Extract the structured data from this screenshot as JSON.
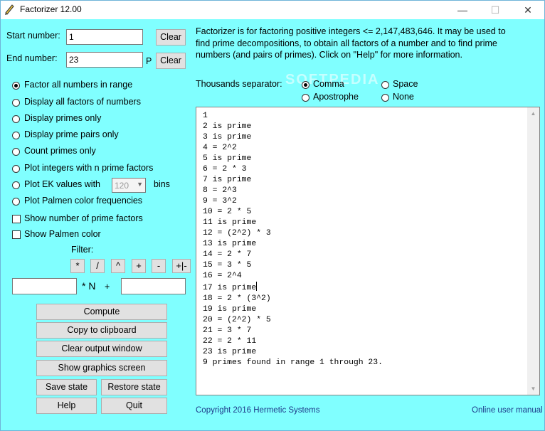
{
  "window": {
    "title": "Factorizer 12.00",
    "minimize": "—",
    "maximize": "☐",
    "close": "✕"
  },
  "inputs": {
    "start_label": "Start number:",
    "start_value": "1",
    "start_clear": "Clear",
    "end_label": "End number:",
    "end_value": "23",
    "end_p": "P",
    "end_clear": "Clear"
  },
  "modes": [
    {
      "label": "Factor all numbers in range",
      "selected": true
    },
    {
      "label": "Display all factors of numbers",
      "selected": false
    },
    {
      "label": "Display primes only",
      "selected": false
    },
    {
      "label": "Display prime pairs only",
      "selected": false
    },
    {
      "label": "Count primes only",
      "selected": false
    },
    {
      "label": "Plot integers with n  prime factors",
      "selected": false
    },
    {
      "label": "Plot EK values with",
      "selected": false,
      "combo_value": "120",
      "suffix": "bins"
    },
    {
      "label": "Plot Palmen color frequencies",
      "selected": false
    }
  ],
  "checks": [
    {
      "label": "Show number of prime factors",
      "checked": false
    },
    {
      "label": "Show Palmen color",
      "checked": false
    }
  ],
  "filter": {
    "label": "Filter:",
    "ops": [
      "*",
      "/",
      "^",
      "+",
      "-",
      "+|-"
    ],
    "times_n": "* N",
    "plus": "+",
    "a_value": "",
    "b_value": ""
  },
  "actions": {
    "compute": "Compute",
    "copy": "Copy to clipboard",
    "clear_output": "Clear output window",
    "graphics": "Show graphics screen",
    "save": "Save state",
    "restore": "Restore state",
    "help": "Help",
    "quit": "Quit"
  },
  "info": {
    "line1": "Factorizer is for factoring positive integers <= 2,147,483,646.  It may be used to",
    "line2": "find prime decompositions, to obtain all factors of a number and to find prime",
    "line3": "numbers (and pairs of primes).  Click on \"Help\" for more information."
  },
  "separator": {
    "label": "Thousands separator:",
    "options": [
      {
        "label": "Comma",
        "selected": true
      },
      {
        "label": "Space",
        "selected": false
      },
      {
        "label": "Apostrophe",
        "selected": false
      },
      {
        "label": "None",
        "selected": false
      }
    ]
  },
  "output": {
    "lines": [
      "1",
      "2 is prime",
      "3 is prime",
      "4 = 2^2",
      "5 is prime",
      "6 = 2 * 3",
      "7 is prime",
      "8 = 2^3",
      "9 = 3^2",
      "10 = 2 * 5",
      "11 is prime",
      "12 = (2^2) * 3",
      "13 is prime",
      "14 = 2 * 7",
      "15 = 3 * 5",
      "16 = 2^4",
      "17 is prime",
      "18 = 2 * (3^2)",
      "19 is prime",
      "20 = (2^2) * 5",
      "21 = 3 * 7",
      "22 = 2 * 11",
      "23 is prime",
      "9 primes found in range 1 through 23."
    ],
    "caret_after_line": 16
  },
  "footer": {
    "copyright": "Copyright 2016 Hermetic Systems",
    "manual": "Online user manual"
  },
  "watermark": "SOFTPEDIA"
}
